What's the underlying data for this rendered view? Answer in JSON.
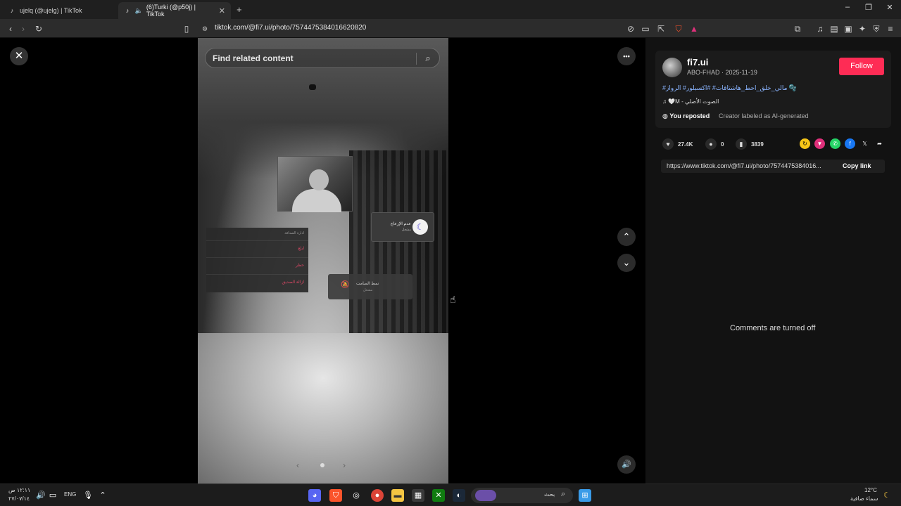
{
  "browser": {
    "tabs": [
      {
        "label": "ujelq (@ujelg) | TikTok",
        "icon": "tiktok-icon"
      },
      {
        "label": "(6)Turki (@p50j) | TikTok",
        "icon": "tiktok-icon",
        "audio_icon": "speaker-icon",
        "active": true
      }
    ],
    "new_tab": "+",
    "window_controls": {
      "minimize": "–",
      "maximize": "❐",
      "close": "✕"
    },
    "url": "tiktok.com/@fi7.ui/photo/7574475384016620820"
  },
  "viewer": {
    "search_placeholder": "Find related content",
    "close_icon": "✕",
    "more_icon": "•••",
    "nav_up_icon": "⌃",
    "nav_down_icon": "⌄",
    "volume_icon": "🔊",
    "carousel_prev": "‹",
    "carousel_next": "›",
    "overlay": {
      "menu_header": "ادارة الصداقة",
      "menu_items": [
        "ابلغ",
        "حظر",
        "ازالة الصديق"
      ],
      "dnd_title": "عدم الإزعاج",
      "dnd_status": "مشغل",
      "silent_title": "نمط الصامت",
      "silent_status": "مشغل"
    }
  },
  "post": {
    "username": "fi7.ui",
    "subline": "ABO-FHAD · 2025-11-19",
    "follow_label": "Follow",
    "hashtags": "🫧 مالي_خلق_احط_هاشتاقات# #اكسبلور# الرواز#",
    "sound": "♫ 🤍M - الصوت الأصلي",
    "reposted_label": "You reposted",
    "ai_label": "Creator labeled as AI-generated",
    "stats": {
      "likes": "27.4K",
      "comments": "0",
      "saves": "3839"
    },
    "share_link": "https://www.tiktok.com/@fi7.ui/photo/7574475384016...",
    "copy_link_label": "Copy link",
    "comments_off": "Comments are turned off",
    "colors": {
      "follow": "#fe2c55",
      "hashtag": "#8ab4ff"
    }
  },
  "taskbar": {
    "lang": "ENG",
    "clock_time": "١٢:١١ ص",
    "clock_date": "٢٧/٠٧/١٤",
    "search_label": "بحث",
    "weather_temp": "12°C",
    "weather_desc": "سماء صافية"
  }
}
